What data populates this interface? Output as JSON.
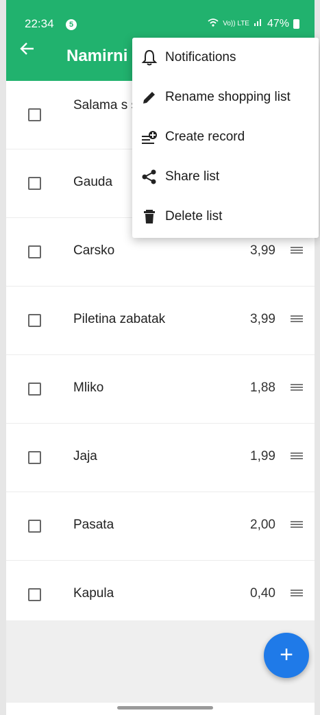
{
  "status_bar": {
    "time": "22:34",
    "notification_count": "5",
    "network": "Vo)) LTE",
    "battery": "47%"
  },
  "app_bar": {
    "title": "Namirni"
  },
  "menu": {
    "items": [
      {
        "label": "Notifications",
        "icon": "bell-icon"
      },
      {
        "label": "Rename shopping list",
        "icon": "pencil-icon"
      },
      {
        "label": "Create record",
        "icon": "add-record-icon"
      },
      {
        "label": "Share list",
        "icon": "share-icon"
      },
      {
        "label": "Delete list",
        "icon": "trash-icon"
      }
    ]
  },
  "items": [
    {
      "name": "Salama s sljeme",
      "price": ""
    },
    {
      "name": "Gauda",
      "price": ""
    },
    {
      "name": "Carsko",
      "price": "3,99"
    },
    {
      "name": "Piletina zabatak",
      "price": "3,99"
    },
    {
      "name": "Mliko",
      "price": "1,88"
    },
    {
      "name": "Jaja",
      "price": "1,99"
    },
    {
      "name": "Pasata",
      "price": "2,00"
    },
    {
      "name": "Kapula",
      "price": "0,40"
    }
  ],
  "fab": {
    "label": "+"
  },
  "colors": {
    "primary": "#21b26e",
    "fab": "#1f7ae8"
  }
}
